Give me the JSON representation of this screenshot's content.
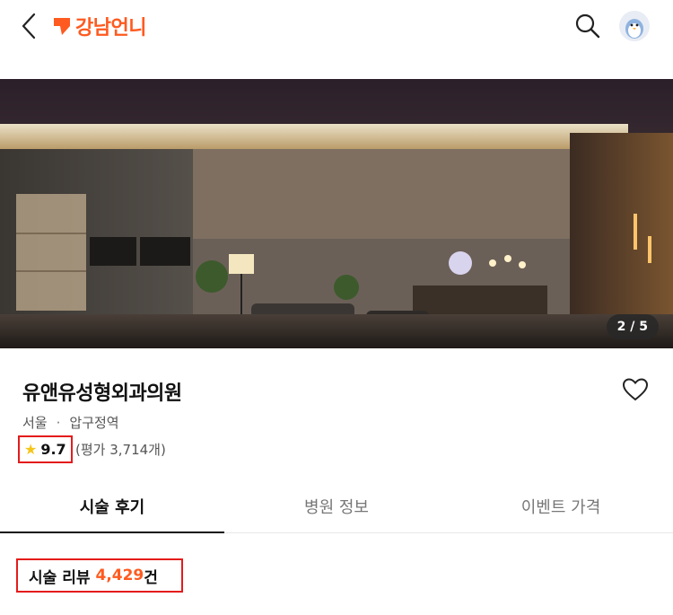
{
  "header": {
    "logo_text": "강남언니",
    "icons": [
      "chevron-left-icon",
      "search-icon",
      "penguin-avatar-icon"
    ]
  },
  "hero": {
    "photo_counter": "2 / 5"
  },
  "clinic": {
    "name": "유앤유성형외과의원",
    "city": "서울",
    "separator": "·",
    "district": "압구정역",
    "rating": "9.7",
    "rating_count_label": "(평가 3,714개)"
  },
  "tabs": [
    {
      "label": "시술 후기",
      "active": true
    },
    {
      "label": "병원 정보",
      "active": false
    },
    {
      "label": "이벤트 가격",
      "active": false
    }
  ],
  "reviews": {
    "label": "시술 리뷰",
    "count": "4,429",
    "unit": "건"
  },
  "colors": {
    "brand": "#ff5a1f",
    "highlight_border": "#e41b1b",
    "star": "#f5c518"
  }
}
